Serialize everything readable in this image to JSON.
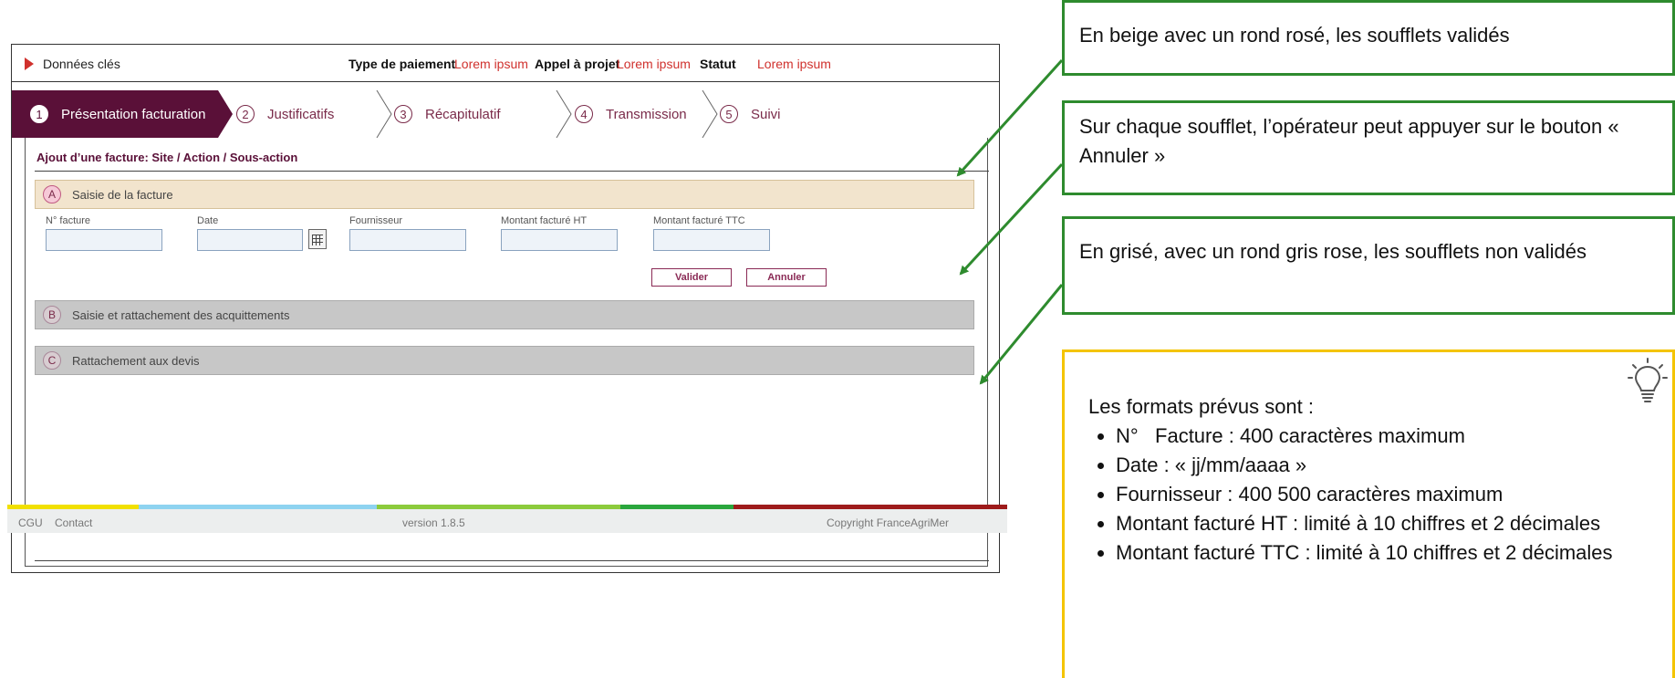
{
  "topbar": {
    "key_data": "Données clés",
    "payment_type_label": "Type de paiement",
    "payment_type_value": "Lorem ipsum",
    "call_label": "Appel à projet",
    "call_value": "Lorem ipsum",
    "status_label": "Statut",
    "status_value": "Lorem ipsum"
  },
  "steps": [
    {
      "num": "1",
      "label": "Présentation facturation"
    },
    {
      "num": "2",
      "label": "Justificatifs"
    },
    {
      "num": "3",
      "label": "Récapitulatif"
    },
    {
      "num": "4",
      "label": "Transmission"
    },
    {
      "num": "5",
      "label": "Suivi"
    }
  ],
  "form": {
    "title": "Ajout d’une facture: Site / Action / Sous-action",
    "sections": [
      {
        "letter": "A",
        "label": "Saisie de la facture"
      },
      {
        "letter": "B",
        "label": "Saisie et rattachement des acquittements"
      },
      {
        "letter": "C",
        "label": "Rattachement aux devis"
      }
    ],
    "fields": [
      {
        "label": "N° facture",
        "value": ""
      },
      {
        "label": "Date",
        "value": ""
      },
      {
        "label": "Fournisseur",
        "value": ""
      },
      {
        "label": "Montant facturé HT",
        "value": ""
      },
      {
        "label": "Montant facturé TTC",
        "value": ""
      }
    ],
    "validate": "Valider",
    "cancel": "Annuler"
  },
  "footer": {
    "cgu": "CGU",
    "contact": "Contact",
    "version": "version 1.8.5",
    "copyright": "Copyright FranceAgriMer"
  },
  "notes": [
    "En beige avec un rond rosé, les soufflets validés",
    "Sur chaque soufflet, l’opérateur peut appuyer sur le bouton « Annuler »",
    "En grisé, avec un rond gris rose, les soufflets non validés"
  ],
  "tip": {
    "intro": "Les formats prévus sont :",
    "items": [
      "N°   Facture : 400 caractères maximum",
      "Date : « jj/mm/aaaa »",
      "Fournisseur : 400 500 caractères maximum",
      "Montant facturé HT : limité à 10 chiffres et 2 décimales",
      "Montant facturé TTC : limité à 10 chiffres et 2 décimales"
    ]
  },
  "colors": {
    "brand": "#5a1038",
    "accent_red": "#d0312d",
    "validated_section": "#f2e4cd",
    "pending_section": "#c7c7c7",
    "note_border": "#2e8b2e",
    "tip_border": "#f4c400",
    "footer_stripes": [
      "#f1e000",
      "#8ed3f0",
      "#8ccb3c",
      "#2aa63d",
      "#9e1b1b"
    ]
  },
  "icons": [
    "play-arrow-icon",
    "calendar-icon",
    "lightbulb-icon"
  ]
}
